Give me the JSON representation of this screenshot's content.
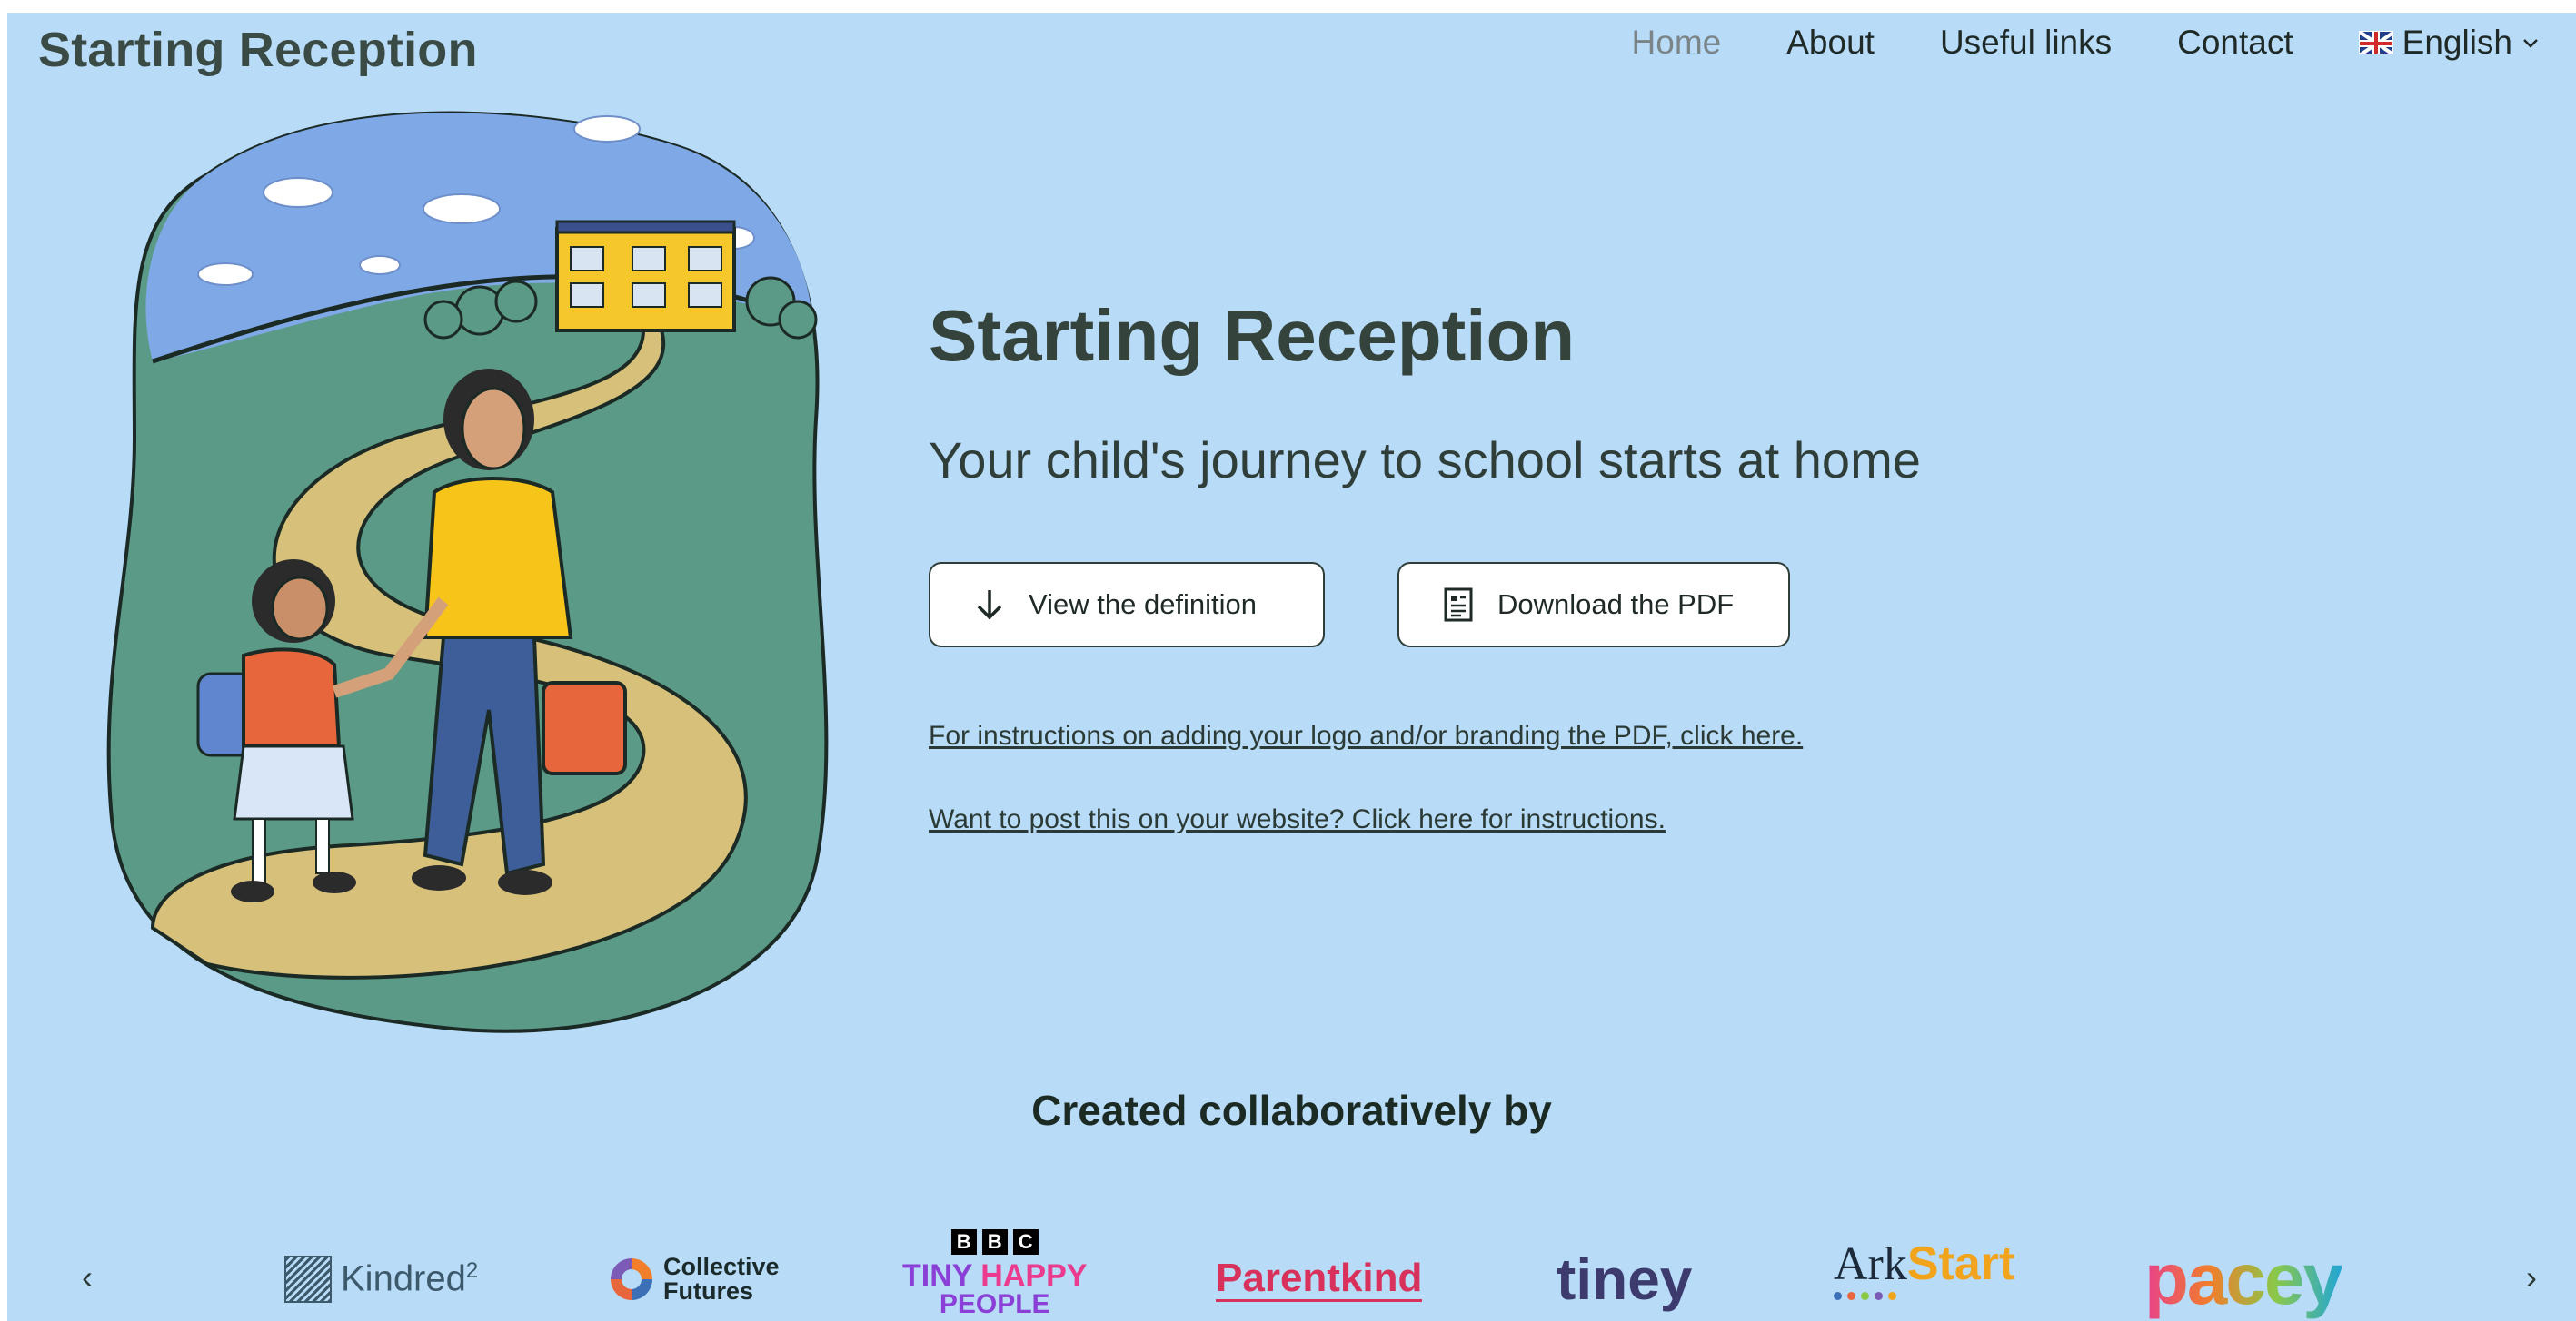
{
  "header": {
    "brand": "Starting Reception",
    "nav": [
      {
        "label": "Home",
        "active": true
      },
      {
        "label": "About",
        "active": false
      },
      {
        "label": "Useful links",
        "active": false
      },
      {
        "label": "Contact",
        "active": false
      }
    ],
    "language": {
      "label": "English",
      "flag": "uk-flag-icon",
      "dropdown_icon": "chevron-down-icon"
    }
  },
  "hero": {
    "title": "Starting Reception",
    "subtitle": "Your child's journey to school starts at home",
    "buttons": {
      "view_definition": {
        "label": "View the definition",
        "icon": "arrow-down-icon"
      },
      "download_pdf": {
        "label": "Download the PDF",
        "icon": "document-icon"
      }
    },
    "links": {
      "branding": "For instructions on adding your logo and/or branding the PDF, click here.",
      "website": "Want to post this on your website? Click here for instructions."
    }
  },
  "partners": {
    "heading": "Created collaboratively by",
    "prev_arrow": "‹",
    "next_arrow": "›",
    "logos": {
      "kindred": {
        "text": "Kindred",
        "sup": "2"
      },
      "collective_futures": {
        "line1": "Collective",
        "line2": "Futures"
      },
      "bbc": {
        "letters": [
          "B",
          "B",
          "C"
        ],
        "line1a": "TINY ",
        "line1b": "HAPPY",
        "line2": "PEOPLE"
      },
      "parentkind": {
        "text": "Parentkind"
      },
      "tiney": {
        "text": "tiney"
      },
      "ark": {
        "text_a": "Ark",
        "text_b": "Start"
      },
      "pacey": {
        "text": "pacey"
      }
    }
  },
  "colors": {
    "page_background": "#b8dbf8",
    "heading": "#34433c",
    "button_bg": "#ffffff"
  }
}
